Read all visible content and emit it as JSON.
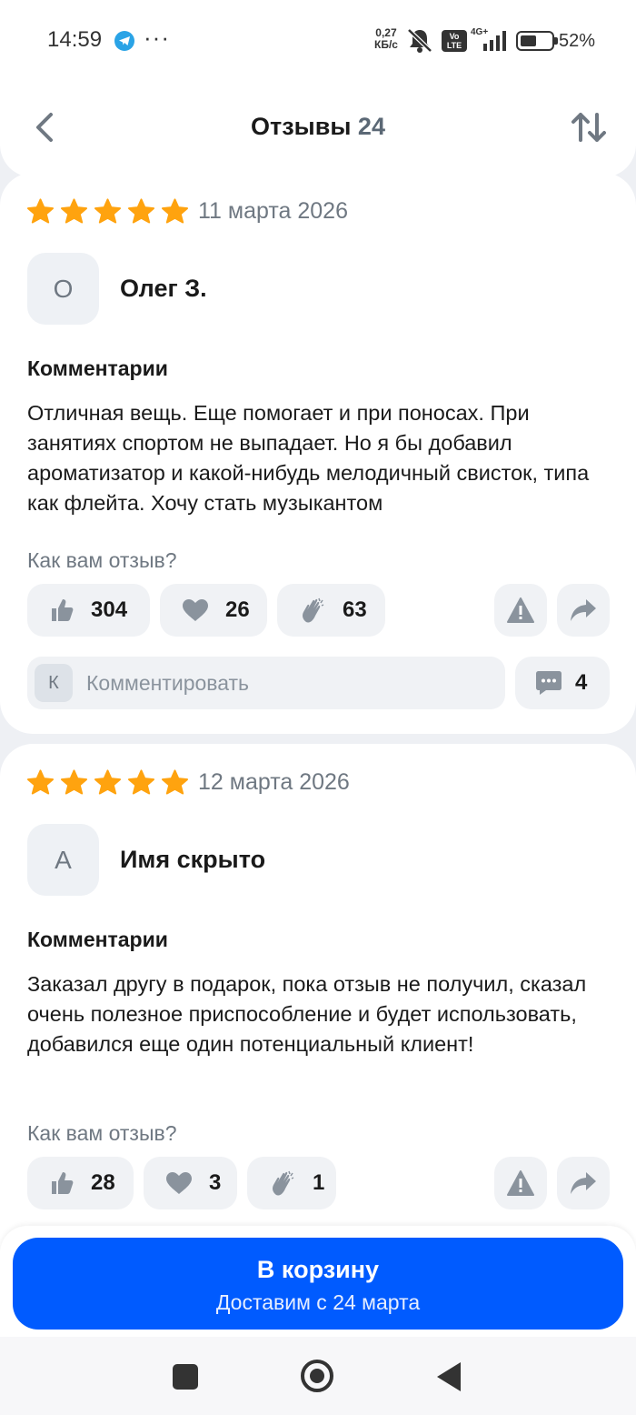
{
  "status_bar": {
    "time": "14:59",
    "more": "···",
    "speed_value": "0,27",
    "speed_unit": "КБ/с",
    "volte_top": "Vo",
    "volte_bottom": "LTE",
    "network": "4G+",
    "battery_percent": "52%",
    "battery_level": 0.52
  },
  "header": {
    "title": "Отзывы",
    "count": "24"
  },
  "reviews": [
    {
      "rating": 5,
      "date": "11 марта 2026",
      "avatar_letter": "О",
      "author": "Олег З.",
      "section_label": "Комментарии",
      "text": "Отличная вещь. Еще помогает и при поносах. При занятиях спортом не выпадает. Но я бы добавил ароматизатор и какой-нибудь мелодичный свисток, типа как флейта. Хочу стать музыкантом",
      "rate_question": "Как вам отзыв?",
      "likes": "304",
      "hearts": "26",
      "claps": "63",
      "comment_avatar": "К",
      "comment_placeholder": "Комментировать",
      "comments_count": "4"
    },
    {
      "rating": 5,
      "date": "12 марта 2026",
      "avatar_letter": "А",
      "author": "Имя скрыто",
      "section_label": "Комментарии",
      "text": "Заказал другу в подарок, пока отзыв не получил, сказал очень полезное приспособление и будет использовать, добавился еще один потенциальный клиент!",
      "rate_question": "Как вам отзыв?",
      "likes": "28",
      "hearts": "3",
      "claps": "1"
    }
  ],
  "cart": {
    "button_label": "В корзину",
    "delivery": "Доставим с 24 марта"
  },
  "colors": {
    "accent": "#005bff",
    "star": "#ffa30f",
    "muted_text": "#6f7882",
    "chip_bg": "#f0f2f5",
    "icon_gray": "#8a939d"
  },
  "icons": [
    "telegram-icon",
    "mute-icon",
    "signal-icon",
    "battery-icon",
    "back-arrow-icon",
    "sort-icon",
    "star-icon",
    "thumbs-up-icon",
    "heart-icon",
    "clap-icon",
    "warning-icon",
    "share-icon",
    "comment-bubble-icon"
  ]
}
